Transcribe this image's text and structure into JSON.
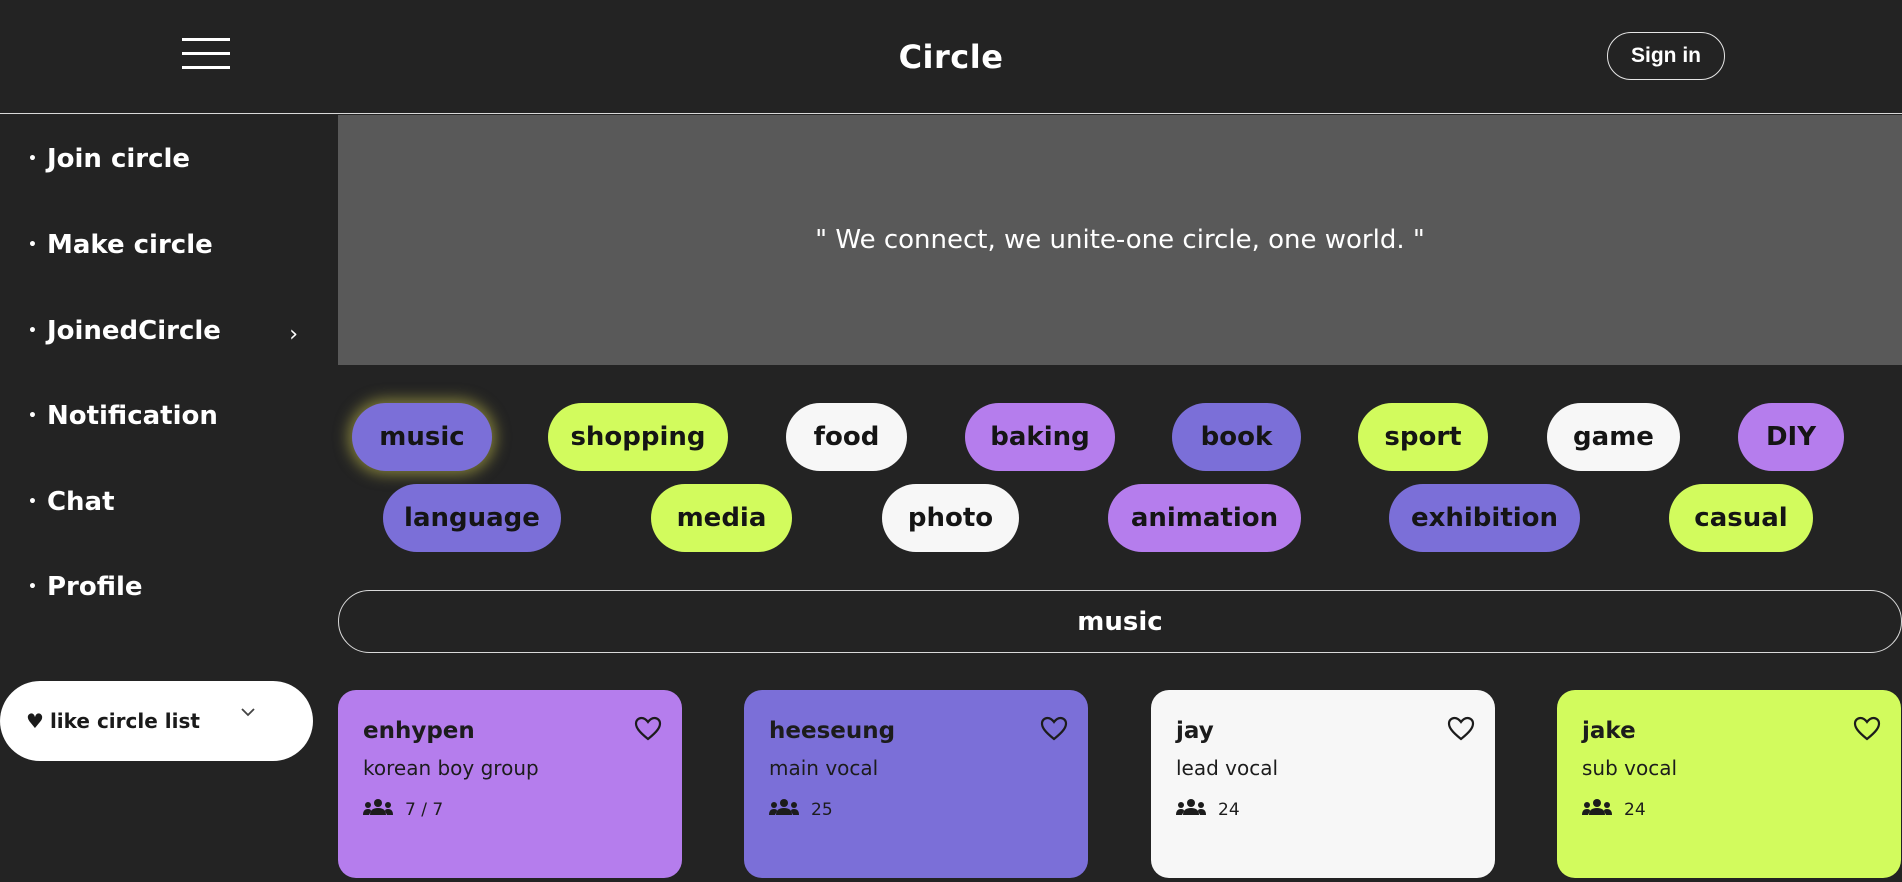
{
  "header": {
    "title": "Circle",
    "signin_label": "Sign in"
  },
  "sidebar": {
    "items": [
      {
        "label": "Join circle"
      },
      {
        "label": "Make circle"
      },
      {
        "label": "JoinedCircle"
      },
      {
        "label": "Notification"
      },
      {
        "label": "Chat"
      },
      {
        "label": "Profile"
      }
    ],
    "like_list_label": "like circle list"
  },
  "banner": {
    "quote": "\" We connect, we unite-one circle, one world. \""
  },
  "categories": [
    {
      "label": "music",
      "color": "#7b6fd8"
    },
    {
      "label": "shopping",
      "color": "#d2fb5d"
    },
    {
      "label": "food",
      "color": "#f7f7f7"
    },
    {
      "label": "baking",
      "color": "#b57ded"
    },
    {
      "label": "book",
      "color": "#7b6fd8"
    },
    {
      "label": "sport",
      "color": "#d2fb5d"
    },
    {
      "label": "game",
      "color": "#f7f7f7"
    },
    {
      "label": "DIY",
      "color": "#b57ded"
    },
    {
      "label": "language",
      "color": "#7b6fd8"
    },
    {
      "label": "media",
      "color": "#d2fb5d"
    },
    {
      "label": "photo",
      "color": "#f7f7f7"
    },
    {
      "label": "animation",
      "color": "#b57ded"
    },
    {
      "label": "exhibition",
      "color": "#7b6fd8"
    },
    {
      "label": "casual",
      "color": "#d2fb5d"
    }
  ],
  "selected_category": "music",
  "cards": [
    {
      "name": "enhypen",
      "desc": "korean boy group",
      "members": "7 / 7",
      "color": "#b57ded"
    },
    {
      "name": "heeseung",
      "desc": "main vocal",
      "members": "25",
      "color": "#7b6fd8"
    },
    {
      "name": "jay",
      "desc": "lead vocal",
      "members": "24",
      "color": "#f7f7f7"
    },
    {
      "name": "jake",
      "desc": "sub vocal",
      "members": "24",
      "color": "#d2fb5d"
    }
  ]
}
